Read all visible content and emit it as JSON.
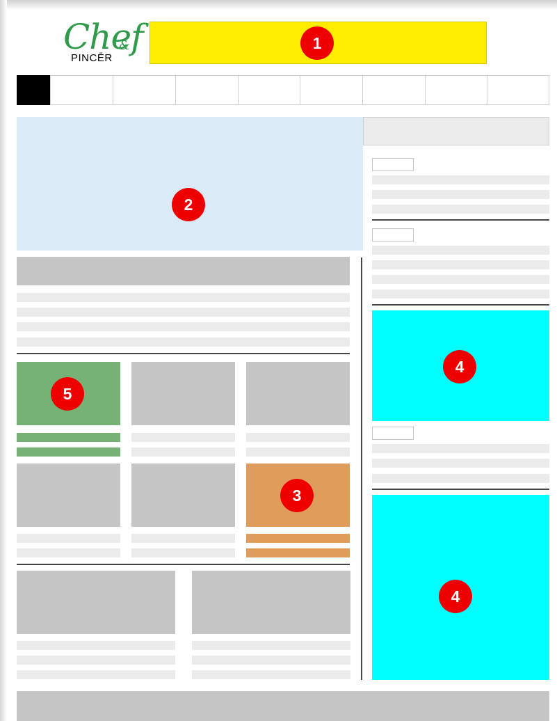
{
  "logo": {
    "chef": "Chef",
    "amp": "&",
    "pincer": "PINCĒR",
    "chef_color": "#2e9a4a"
  },
  "markers": {
    "banner": "1",
    "hero": "2",
    "tile_orange": "3",
    "ad_top": "4",
    "ad_bottom": "4",
    "tile_green": "5"
  },
  "colors": {
    "banner": "#ffed00",
    "hero": "#dbeaf7",
    "ad": "#00ffff",
    "tile_green": "#76b275",
    "tile_orange": "#e09c5b",
    "placeholder": "#c5c5c5",
    "text_line": "#ebebeb",
    "marker": "#ee0000"
  },
  "nav": {
    "tab_count": 9,
    "active_tab": 0
  }
}
